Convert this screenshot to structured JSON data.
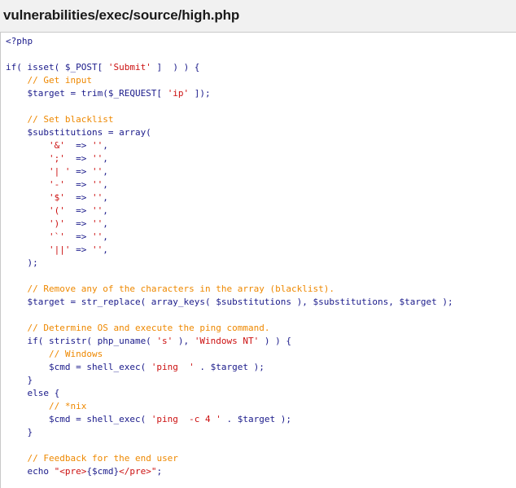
{
  "page": {
    "title": "vulnerabilities/exec/source/high.php"
  },
  "code": {
    "lines": [
      [
        {
          "c": "kw",
          "t": "<?php"
        }
      ],
      [],
      [
        {
          "c": "kw",
          "t": "if( isset( $_POST[ "
        },
        {
          "c": "str",
          "t": "'Submit'"
        },
        {
          "c": "kw",
          "t": " ]  ) ) {"
        }
      ],
      [
        {
          "c": "kw",
          "t": "    "
        },
        {
          "c": "com",
          "t": "// Get input"
        }
      ],
      [
        {
          "c": "kw",
          "t": "    $target = trim($_REQUEST[ "
        },
        {
          "c": "str",
          "t": "'ip'"
        },
        {
          "c": "kw",
          "t": " ]);"
        }
      ],
      [],
      [
        {
          "c": "kw",
          "t": "    "
        },
        {
          "c": "com",
          "t": "// Set blacklist"
        }
      ],
      [
        {
          "c": "kw",
          "t": "    $substitutions = array("
        }
      ],
      [
        {
          "c": "kw",
          "t": "        "
        },
        {
          "c": "str",
          "t": "'&'"
        },
        {
          "c": "kw",
          "t": "  => "
        },
        {
          "c": "str",
          "t": "''"
        },
        {
          "c": "kw",
          "t": ","
        }
      ],
      [
        {
          "c": "kw",
          "t": "        "
        },
        {
          "c": "str",
          "t": "';'"
        },
        {
          "c": "kw",
          "t": "  => "
        },
        {
          "c": "str",
          "t": "''"
        },
        {
          "c": "kw",
          "t": ","
        }
      ],
      [
        {
          "c": "kw",
          "t": "        "
        },
        {
          "c": "str",
          "t": "'| '"
        },
        {
          "c": "kw",
          "t": " => "
        },
        {
          "c": "str",
          "t": "''"
        },
        {
          "c": "kw",
          "t": ","
        }
      ],
      [
        {
          "c": "kw",
          "t": "        "
        },
        {
          "c": "str",
          "t": "'-'"
        },
        {
          "c": "kw",
          "t": "  => "
        },
        {
          "c": "str",
          "t": "''"
        },
        {
          "c": "kw",
          "t": ","
        }
      ],
      [
        {
          "c": "kw",
          "t": "        "
        },
        {
          "c": "str",
          "t": "'$'"
        },
        {
          "c": "kw",
          "t": "  => "
        },
        {
          "c": "str",
          "t": "''"
        },
        {
          "c": "kw",
          "t": ","
        }
      ],
      [
        {
          "c": "kw",
          "t": "        "
        },
        {
          "c": "str",
          "t": "'('"
        },
        {
          "c": "kw",
          "t": "  => "
        },
        {
          "c": "str",
          "t": "''"
        },
        {
          "c": "kw",
          "t": ","
        }
      ],
      [
        {
          "c": "kw",
          "t": "        "
        },
        {
          "c": "str",
          "t": "')'"
        },
        {
          "c": "kw",
          "t": "  => "
        },
        {
          "c": "str",
          "t": "''"
        },
        {
          "c": "kw",
          "t": ","
        }
      ],
      [
        {
          "c": "kw",
          "t": "        "
        },
        {
          "c": "str",
          "t": "'`'"
        },
        {
          "c": "kw",
          "t": "  => "
        },
        {
          "c": "str",
          "t": "''"
        },
        {
          "c": "kw",
          "t": ","
        }
      ],
      [
        {
          "c": "kw",
          "t": "        "
        },
        {
          "c": "str",
          "t": "'||'"
        },
        {
          "c": "kw",
          "t": " => "
        },
        {
          "c": "str",
          "t": "''"
        },
        {
          "c": "kw",
          "t": ","
        }
      ],
      [
        {
          "c": "kw",
          "t": "    );"
        }
      ],
      [],
      [
        {
          "c": "kw",
          "t": "    "
        },
        {
          "c": "com",
          "t": "// Remove any of the characters in the array (blacklist)."
        }
      ],
      [
        {
          "c": "kw",
          "t": "    $target = str_replace( array_keys( $substitutions ), $substitutions, $target );"
        }
      ],
      [],
      [
        {
          "c": "kw",
          "t": "    "
        },
        {
          "c": "com",
          "t": "// Determine OS and execute the ping command."
        }
      ],
      [
        {
          "c": "kw",
          "t": "    if( stristr( php_uname( "
        },
        {
          "c": "str",
          "t": "'s'"
        },
        {
          "c": "kw",
          "t": " ), "
        },
        {
          "c": "str",
          "t": "'Windows NT'"
        },
        {
          "c": "kw",
          "t": " ) ) {"
        }
      ],
      [
        {
          "c": "kw",
          "t": "        "
        },
        {
          "c": "com",
          "t": "// Windows"
        }
      ],
      [
        {
          "c": "kw",
          "t": "        $cmd = shell_exec( "
        },
        {
          "c": "str",
          "t": "'ping  '"
        },
        {
          "c": "kw",
          "t": " . $target );"
        }
      ],
      [
        {
          "c": "kw",
          "t": "    }"
        }
      ],
      [
        {
          "c": "kw",
          "t": "    else {"
        }
      ],
      [
        {
          "c": "kw",
          "t": "        "
        },
        {
          "c": "com",
          "t": "// *nix"
        }
      ],
      [
        {
          "c": "kw",
          "t": "        $cmd = shell_exec( "
        },
        {
          "c": "str",
          "t": "'ping  -c 4 '"
        },
        {
          "c": "kw",
          "t": " . $target );"
        }
      ],
      [
        {
          "c": "kw",
          "t": "    }"
        }
      ],
      [],
      [
        {
          "c": "kw",
          "t": "    "
        },
        {
          "c": "com",
          "t": "// Feedback for the end user"
        }
      ],
      [
        {
          "c": "kw",
          "t": "    echo "
        },
        {
          "c": "str",
          "t": "\"<pre>"
        },
        {
          "c": "kw",
          "t": "{$cmd}"
        },
        {
          "c": "str",
          "t": "</pre>\""
        },
        {
          "c": "kw",
          "t": ";"
        }
      ]
    ]
  },
  "colors": {
    "default": "#1a1a8a",
    "string": "#cc1111",
    "comment": "#ee8800",
    "background": "#ffffff",
    "chrome": "#f1f1f1"
  }
}
